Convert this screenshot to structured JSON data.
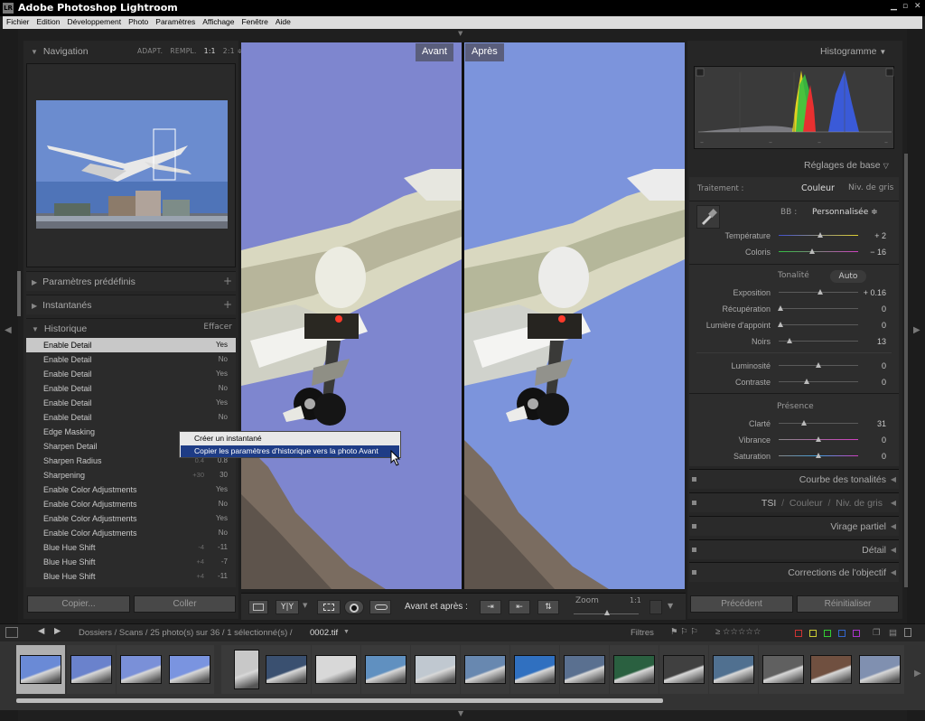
{
  "titlebar": {
    "logo": "LR",
    "title": "Adobe Photoshop Lightroom",
    "controls": [
      "▁",
      "▫",
      "✕"
    ]
  },
  "menubar": {
    "items": [
      "Fichier",
      "Edition",
      "Développement",
      "Photo",
      "Paramètres",
      "Affichage",
      "Fenêtre",
      "Aide"
    ]
  },
  "left": {
    "navigation": {
      "title": "Navigation",
      "opts": [
        "ADAPT.",
        "REMPL.",
        "1:1",
        "2:1 ≑"
      ]
    },
    "presets": {
      "title": "Paramètres prédéfinis",
      "add": "+"
    },
    "snapshots": {
      "title": "Instantanés",
      "add": "+"
    },
    "history": {
      "title": "Historique",
      "clear": "Effacer",
      "rows": [
        {
          "name": "Enable Detail",
          "before": "",
          "after": "Yes"
        },
        {
          "name": "Enable Detail",
          "before": "",
          "after": "No"
        },
        {
          "name": "Enable Detail",
          "before": "",
          "after": "Yes"
        },
        {
          "name": "Enable Detail",
          "before": "",
          "after": "No"
        },
        {
          "name": "Enable Detail",
          "before": "",
          "after": "Yes"
        },
        {
          "name": "Enable Detail",
          "before": "",
          "after": "No"
        },
        {
          "name": "Edge Masking",
          "before": "",
          "after": ""
        },
        {
          "name": "Sharpen Detail",
          "before": "",
          "after": ""
        },
        {
          "name": "Sharpen Radius",
          "before": "0.4",
          "after": "0.8"
        },
        {
          "name": "Sharpening",
          "before": "+30",
          "after": "30"
        },
        {
          "name": "Enable Color Adjustments",
          "before": "",
          "after": "Yes"
        },
        {
          "name": "Enable Color Adjustments",
          "before": "",
          "after": "No"
        },
        {
          "name": "Enable Color Adjustments",
          "before": "",
          "after": "Yes"
        },
        {
          "name": "Enable Color Adjustments",
          "before": "",
          "after": "No"
        },
        {
          "name": "Blue Hue Shift",
          "before": "-4",
          "after": "-11"
        },
        {
          "name": "Blue Hue Shift",
          "before": "+4",
          "after": "-7"
        },
        {
          "name": "Blue Hue Shift",
          "before": "+4",
          "after": "-11"
        }
      ]
    },
    "buttons": {
      "copy": "Copier...",
      "paste": "Coller"
    }
  },
  "context_menu": {
    "items": [
      "Créer un instantané",
      "Copier les paramètres d'historique vers la photo Avant"
    ]
  },
  "view": {
    "before_label": "Avant",
    "after_label": "Après"
  },
  "toolbar": {
    "yy": "Y|Y",
    "before_after": "Avant et après :",
    "zoom": "Zoom",
    "zoom_value": "1:1"
  },
  "right": {
    "histogram": {
      "title": "Histogramme"
    },
    "basic": {
      "title": "Réglages de base",
      "treatment_label": "Traitement :",
      "treatment_color": "Couleur",
      "treatment_gray": "Niv. de gris",
      "wb_label": "BB :",
      "wb_value": "Personnalisée ≑",
      "temp_label": "Température",
      "temp_value": "+ 2",
      "temp_level": 0.52,
      "tint_label": "Coloris",
      "tint_value": "− 16",
      "tint_level": 0.42,
      "tone_label": "Tonalité",
      "tone_auto": "Auto",
      "exposure_label": "Exposition",
      "exposure_value": "+ 0.16",
      "exposure_level": 0.52,
      "recovery_label": "Récupération",
      "recovery_value": "0",
      "recovery_level": 0.02,
      "fill_label": "Lumière d'appoint",
      "fill_value": "0",
      "fill_level": 0.02,
      "blacks_label": "Noirs",
      "blacks_value": "13",
      "blacks_level": 0.14,
      "brightness_label": "Luminosité",
      "brightness_value": "0",
      "brightness_level": 0.5,
      "contrast_label": "Contraste",
      "contrast_value": "0",
      "contrast_level": 0.35,
      "presence_label": "Présence",
      "clarity_label": "Clarté",
      "clarity_value": "31",
      "clarity_level": 0.32,
      "vibrance_label": "Vibrance",
      "vibrance_value": "0",
      "vibrance_level": 0.5,
      "saturation_label": "Saturation",
      "saturation_value": "0",
      "saturation_level": 0.5
    },
    "curve": {
      "title": "Courbe des tonalités"
    },
    "hsl": {
      "tsi": "TSI",
      "sep": "/",
      "color": "Couleur",
      "gray": "Niv. de gris"
    },
    "split": {
      "title": "Virage partiel"
    },
    "detail": {
      "title": "Détail"
    },
    "lens": {
      "title": "Corrections de l'objectif"
    },
    "buttons": {
      "previous": "Précédent",
      "reset": "Réinitialiser"
    }
  },
  "filmbar": {
    "path": "Dossiers / Scans / 25 photo(s) sur 36 / 1 sélectionné(s) /",
    "filename": "0002.tif",
    "filters": "Filtres",
    "stars": "≥ ☆☆☆☆☆"
  }
}
